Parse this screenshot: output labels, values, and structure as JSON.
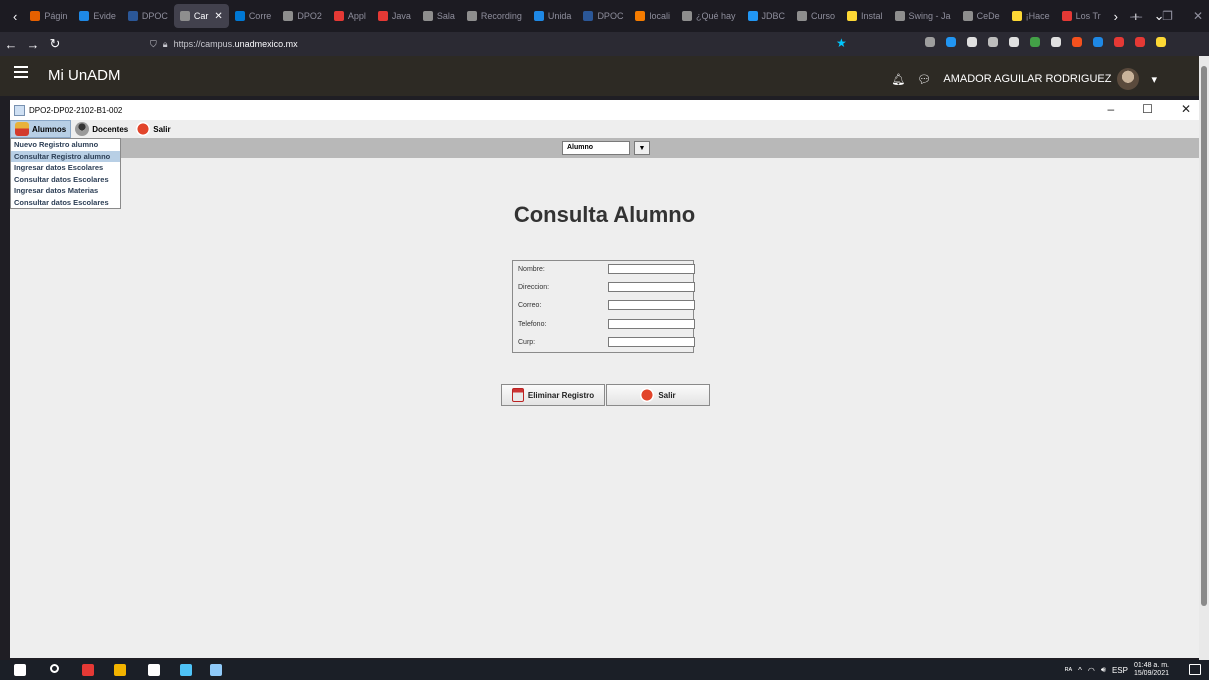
{
  "browser": {
    "tabs": [
      {
        "label": "Págin",
        "color": "#e66000",
        "active": false
      },
      {
        "label": "Evide",
        "color": "#1e88e5",
        "active": false
      },
      {
        "label": "DPOC",
        "color": "#2b5797",
        "active": false
      },
      {
        "label": "Car",
        "color": "#8e8e8e",
        "active": true
      },
      {
        "label": "Corre",
        "color": "#0078d4",
        "active": false
      },
      {
        "label": "DPO2",
        "color": "#8e8e8e",
        "active": false
      },
      {
        "label": "Appl",
        "color": "#e53935",
        "active": false
      },
      {
        "label": "Java",
        "color": "#e53935",
        "active": false
      },
      {
        "label": "Sala",
        "color": "#8e8e8e",
        "active": false
      },
      {
        "label": "Recording",
        "color": "#8e8e8e",
        "active": false
      },
      {
        "label": "Unida",
        "color": "#1e88e5",
        "active": false
      },
      {
        "label": "DPOC",
        "color": "#2b5797",
        "active": false
      },
      {
        "label": "locali",
        "color": "#f57c00",
        "active": false
      },
      {
        "label": "¿Qué hay",
        "color": "#8e8e8e",
        "active": false
      },
      {
        "label": "JDBC",
        "color": "#2196f3",
        "active": false
      },
      {
        "label": "Curso",
        "color": "#8e8e8e",
        "active": false
      },
      {
        "label": "Instal",
        "color": "#fdd835",
        "active": false
      },
      {
        "label": "Swing - Ja",
        "color": "#8e8e8e",
        "active": false
      },
      {
        "label": "CeDe",
        "color": "#8e8e8e",
        "active": false
      },
      {
        "label": "¡Hace",
        "color": "#fdd835",
        "active": false
      },
      {
        "label": "Los Tr",
        "color": "#e53935",
        "active": false
      }
    ],
    "url_prefix": "https://campus.",
    "url_domain": "unadmexico.mx",
    "ext_colors": [
      "#9e9e9e",
      "#2196f3",
      "#e0e0e0",
      "#bdbdbd",
      "#e0e0e0",
      "#43a047",
      "#e0e0e0",
      "#f4511e",
      "#1e88e5",
      "#e53935",
      "#e53935",
      "#fdd835"
    ]
  },
  "campus": {
    "brand": "Mi UnADM",
    "user_name": "AMADOR AGUILAR RODRIGUEZ"
  },
  "window": {
    "title": "DPO2-DP02-2102-B1-002"
  },
  "menubar": {
    "alumnos": "Alumnos",
    "docentes": "Docentes",
    "salir": "Salir"
  },
  "dropdown": {
    "items": [
      "Nuevo Registro alumno",
      "Consultar Registro alumno",
      "Ingresar datos Escolares",
      "Consultar datos Escolares",
      "Ingresar datos Materias",
      "Consultar datos Escolares"
    ],
    "selected_index": 1
  },
  "combo": {
    "value": "Alumno"
  },
  "main": {
    "heading": "Consulta Alumno",
    "fields": [
      {
        "label": "Nombre:",
        "value": ""
      },
      {
        "label": "Direccion:",
        "value": ""
      },
      {
        "label": "Correo:",
        "value": ""
      },
      {
        "label": "Telefono:",
        "value": ""
      },
      {
        "label": "Curp:",
        "value": ""
      }
    ],
    "delete_button": "Eliminar Registro",
    "exit_button": "Salir"
  },
  "taskbar": {
    "lang": "ESP",
    "time": "01:48 a. m.",
    "date": "15/09/2021",
    "icon_colors": [
      "#ffffff",
      "#e53935",
      "#f4b400",
      "#ffffff",
      "#4fc3f7",
      "#90caf9"
    ]
  }
}
